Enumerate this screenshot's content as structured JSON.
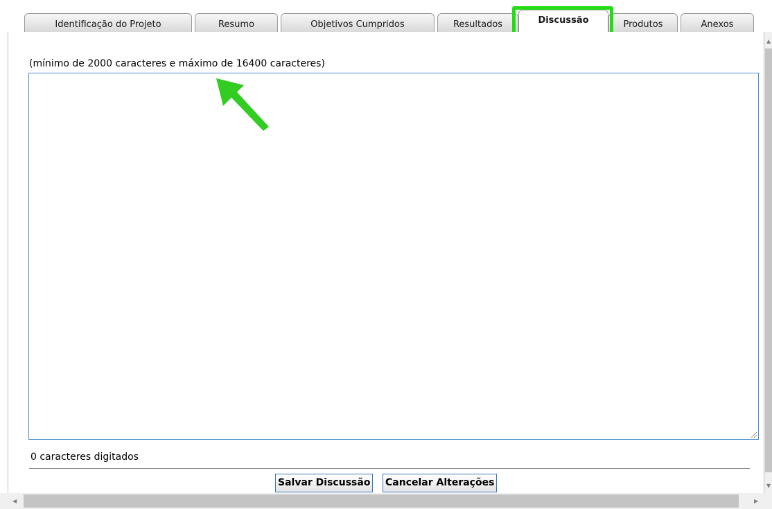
{
  "tabs": [
    {
      "label": "Identificação do Projeto",
      "active": false
    },
    {
      "label": "Resumo",
      "active": false
    },
    {
      "label": "Objetivos Cumpridos",
      "active": false
    },
    {
      "label": "Resultados",
      "active": false
    },
    {
      "label": "Discussão",
      "active": true
    },
    {
      "label": "Produtos",
      "active": false
    },
    {
      "label": "Anexos",
      "active": false
    }
  ],
  "discussion": {
    "hint": "(mínimo de 2000 caracteres e máximo de 16400 caracteres)",
    "text_value": "",
    "char_count": "0 caracteres digitados"
  },
  "buttons": {
    "save": "Salvar Discussão",
    "cancel": "Cancelar Alterações"
  },
  "colors": {
    "highlight": "#22dd11",
    "annotation_arrow": "#33cc22",
    "textarea_border": "#4a8dcf"
  },
  "icons": [
    "arrow-annotation-icon",
    "resize-grip-icon",
    "scroll-up-icon",
    "scroll-down-icon",
    "scroll-left-icon",
    "scroll-right-icon"
  ]
}
